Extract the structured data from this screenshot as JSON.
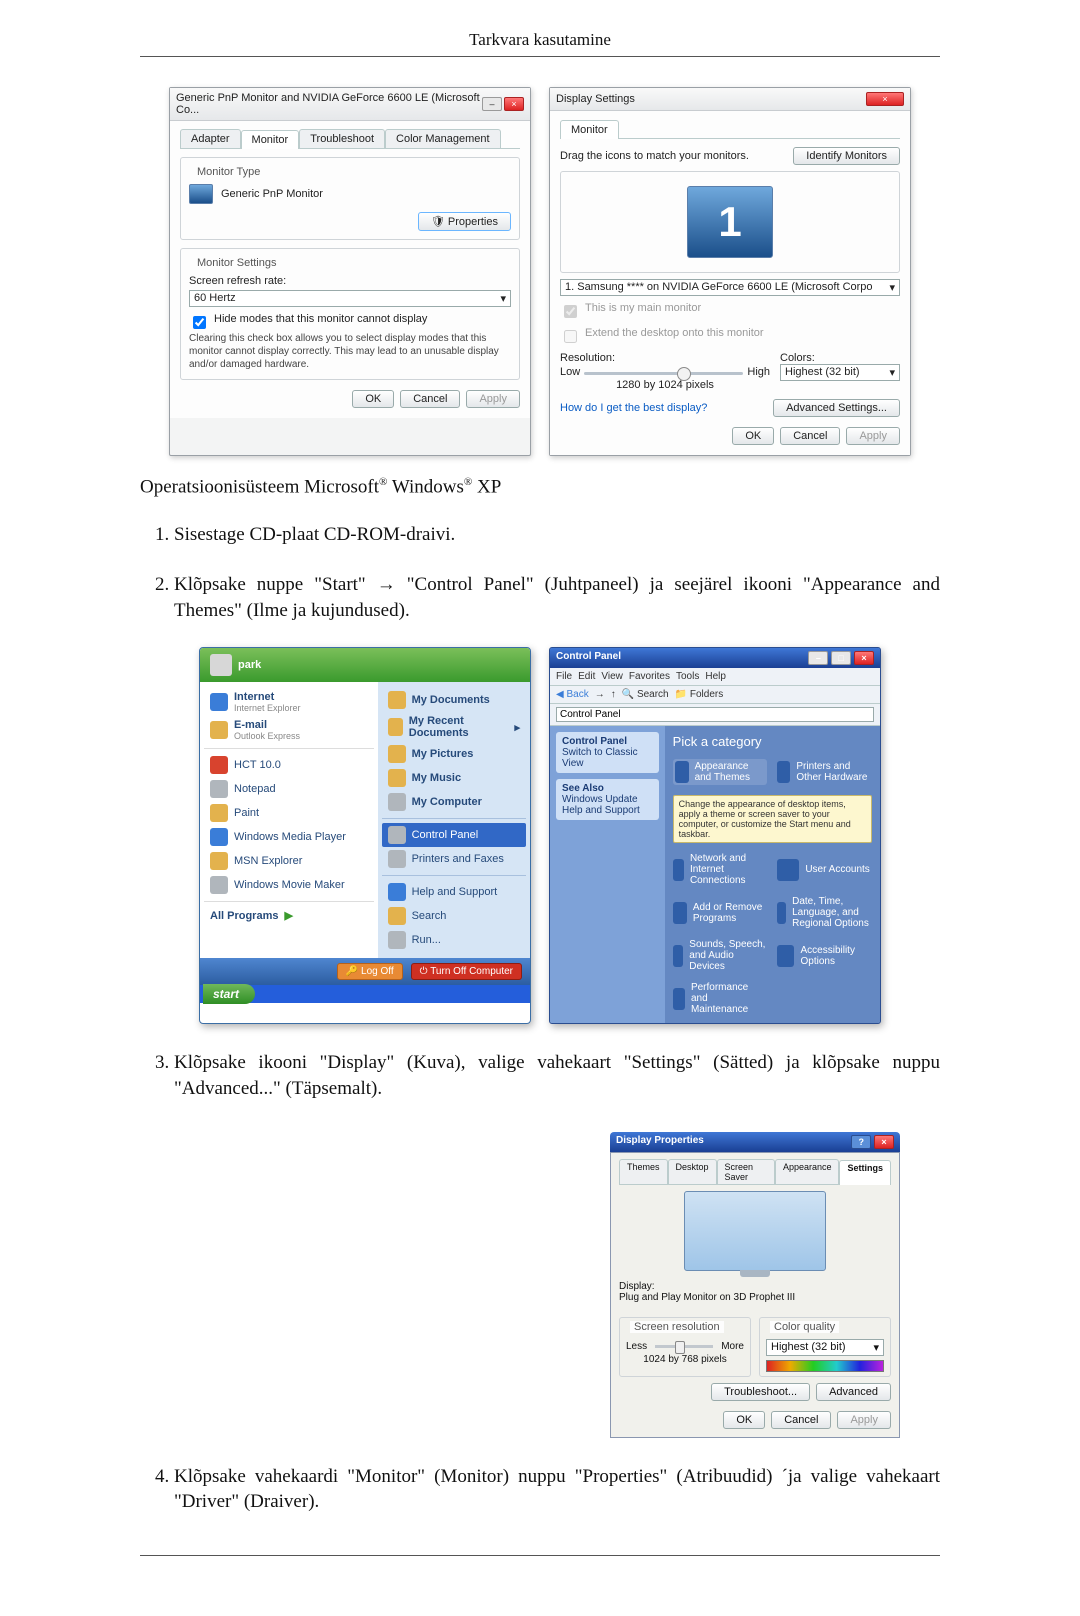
{
  "page_header": "Tarkvara kasutamine",
  "os_text_1": "Operatsioonisüsteem Microsoft",
  "os_text_2": " Windows",
  "os_text_3": " XP",
  "reg": "®",
  "steps": {
    "s1": "Sisestage CD-plaat CD-ROM-draivi.",
    "s2": "Klõpsake nuppe \"Start\" → \"Control Panel\" (Juhtpaneel) ja seejärel ikooni \"Appearance and Themes\" (Ilme ja kujundused).",
    "s3": "Klõpsake ikooni \"Display\" (Kuva), valige vahekaart \"Settings\" (Sätted) ja klõpsake nuppu \"Advanced...\" (Täpsemalt).",
    "s4": "Klõpsake vahekaardi \"Monitor\" (Monitor) nuppu \"Properties\" (Atribuudid) ´ja valige vahekaart \"Driver\" (Draiver)."
  },
  "vista_left": {
    "title": "Generic PnP Monitor and NVIDIA GeForce 6600 LE (Microsoft Co...",
    "tabs": {
      "t1": "Adapter",
      "t2": "Monitor",
      "t3": "Troubleshoot",
      "t4": "Color Management"
    },
    "monitor_type_legend": "Monitor Type",
    "monitor_type_value": "Generic PnP Monitor",
    "properties_btn": "Properties",
    "settings_legend": "Monitor Settings",
    "refresh_label": "Screen refresh rate:",
    "refresh_value": "60 Hertz",
    "hide_modes": "Hide modes that this monitor cannot display",
    "hide_modes_hint": "Clearing this check box allows you to select display modes that this monitor cannot display correctly. This may lead to an unusable display and/or damaged hardware.",
    "ok": "OK",
    "cancel": "Cancel",
    "apply": "Apply"
  },
  "vista_right": {
    "title": "Display Settings",
    "tab": "Monitor",
    "drag_text": "Drag the icons to match your monitors.",
    "identify_btn": "Identify Monitors",
    "monitor_num": "1",
    "device_label": "1. Samsung **** on NVIDIA GeForce 6600 LE (Microsoft Corpo",
    "chk_main": "This is my main monitor",
    "chk_extend": "Extend the desktop onto this monitor",
    "res_label": "Resolution:",
    "res_low": "Low",
    "res_high": "High",
    "res_value": "1280 by 1024 pixels",
    "colors_label": "Colors:",
    "colors_value": "Highest (32 bit)",
    "link": "How do I get the best display?",
    "adv_btn": "Advanced Settings...",
    "ok": "OK",
    "cancel": "Cancel",
    "apply": "Apply"
  },
  "start": {
    "user": "park",
    "left": {
      "internet": "Internet",
      "internet_sub": "Internet Explorer",
      "email": "E-mail",
      "email_sub": "Outlook Express",
      "app1": "HCT 10.0",
      "app2": "Notepad",
      "app3": "Paint",
      "app4": "Windows Media Player",
      "app5": "MSN Explorer",
      "app6": "Windows Movie Maker",
      "all": "All Programs"
    },
    "right": {
      "r1": "My Documents",
      "r2": "My Recent Documents",
      "r3": "My Pictures",
      "r4": "My Music",
      "r5": "My Computer",
      "r6": "Control Panel",
      "r7": "Printers and Faxes",
      "r8": "Help and Support",
      "r9": "Search",
      "r10": "Run..."
    },
    "logoff": "Log Off",
    "turnoff": "Turn Off Computer",
    "startbtn": "start"
  },
  "cpanel": {
    "title": "Control Panel",
    "menu": {
      "file": "File",
      "edit": "Edit",
      "view": "View",
      "fav": "Favorites",
      "tools": "Tools",
      "help": "Help"
    },
    "toolbar": {
      "back": "Back",
      "fwd": "→",
      "up": "↑",
      "search": "Search",
      "folders": "Folders"
    },
    "address_value": "Control Panel",
    "side1_title": "Control Panel",
    "side1_item": "Switch to Classic View",
    "side2_title": "See Also",
    "side2_a": "Windows Update",
    "side2_b": "Help and Support",
    "pick": "Pick a category",
    "cats": {
      "c1": "Appearance and Themes",
      "c2": "Printers and Other Hardware",
      "c1_hint": "Change the appearance of desktop items, apply a theme or screen saver to your computer, or customize the Start menu and taskbar.",
      "c3": "Network and Internet Connections",
      "c4": "User Accounts",
      "c5": "Add or Remove Programs",
      "c6": "Date, Time, Language, and Regional Options",
      "c7": "Sounds, Speech, and Audio Devices",
      "c8": "Accessibility Options",
      "c9": "Performance and Maintenance"
    }
  },
  "disp": {
    "title": "Display Properties",
    "tabs": {
      "t1": "Themes",
      "t2": "Desktop",
      "t3": "Screen Saver",
      "t4": "Appearance",
      "t5": "Settings"
    },
    "display_label": "Display:",
    "display_value": "Plug and Play Monitor on 3D Prophet III",
    "res_legend": "Screen resolution",
    "res_less": "Less",
    "res_more": "More",
    "res_value": "1024 by 768 pixels",
    "color_legend": "Color quality",
    "color_value": "Highest (32 bit)",
    "troubleshoot": "Troubleshoot...",
    "advanced": "Advanced",
    "ok": "OK",
    "cancel": "Cancel",
    "apply": "Apply"
  }
}
